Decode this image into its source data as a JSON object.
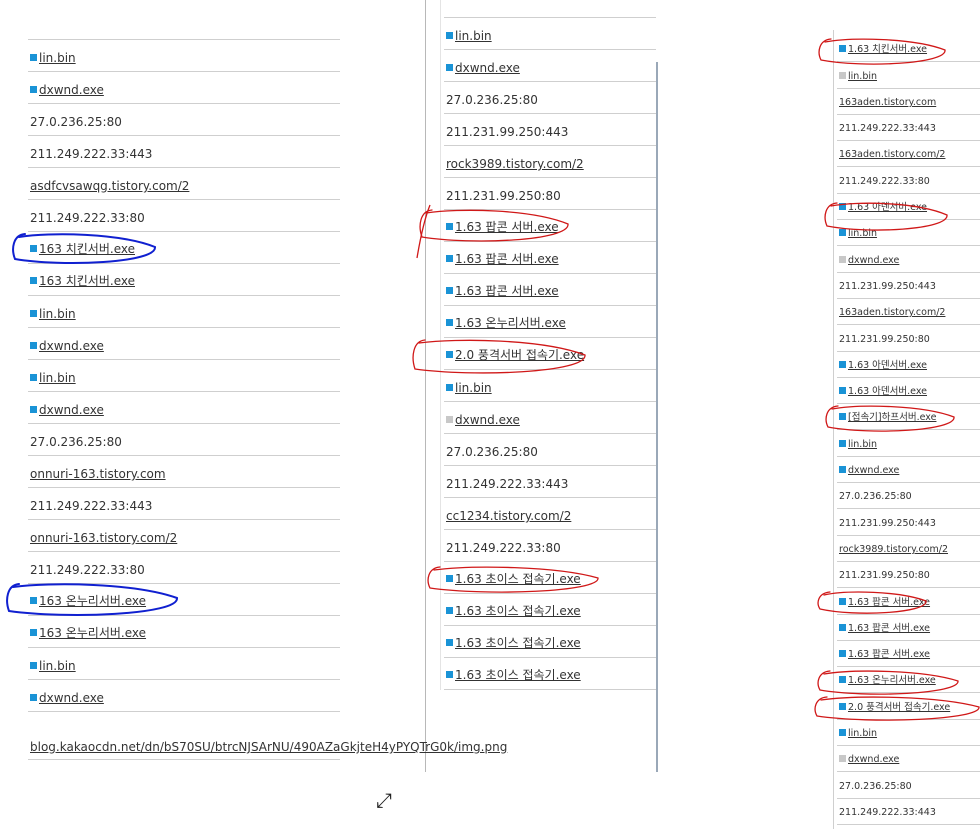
{
  "left_list": [
    {
      "text": "lin.bin",
      "icon": "blue",
      "link": true
    },
    {
      "text": "dxwnd.exe",
      "icon": "blue",
      "link": true
    },
    {
      "text": "27.0.236.25:80",
      "icon": "",
      "link": false
    },
    {
      "text": "211.249.222.33:443",
      "icon": "",
      "link": false
    },
    {
      "text": "asdfcvsawqg.tistory.com/2",
      "icon": "",
      "link": true
    },
    {
      "text": "211.249.222.33:80",
      "icon": "",
      "link": false
    },
    {
      "text": "163 치킨서버.exe",
      "icon": "blue",
      "link": true
    },
    {
      "text": "163 치킨서버.exe",
      "icon": "blue",
      "link": true
    },
    {
      "text": "lin.bin",
      "icon": "blue",
      "link": true
    },
    {
      "text": "dxwnd.exe",
      "icon": "blue",
      "link": true
    },
    {
      "text": "lin.bin",
      "icon": "blue",
      "link": true
    },
    {
      "text": "dxwnd.exe",
      "icon": "blue",
      "link": true
    },
    {
      "text": "27.0.236.25:80",
      "icon": "",
      "link": false
    },
    {
      "text": "onnuri-163.tistory.com",
      "icon": "",
      "link": true
    },
    {
      "text": "211.249.222.33:443",
      "icon": "",
      "link": false
    },
    {
      "text": "onnuri-163.tistory.com/2",
      "icon": "",
      "link": true
    },
    {
      "text": "211.249.222.33:80",
      "icon": "",
      "link": false
    },
    {
      "text": "163 온누리서버.exe",
      "icon": "blue",
      "link": true
    },
    {
      "text": "163 온누리서버.exe",
      "icon": "blue",
      "link": true
    },
    {
      "text": "lin.bin",
      "icon": "blue",
      "link": true
    },
    {
      "text": "dxwnd.exe",
      "icon": "blue",
      "link": true
    },
    {
      "text": "blog.kakaocdn.net/dn/bS70SU/btrcNJSArNU/490AZaGkjteH4yPYQTrG0k/img.png",
      "icon": "",
      "link": true,
      "tall": true
    }
  ],
  "middle_list": [
    {
      "text": "lin.bin",
      "icon": "blue",
      "link": true
    },
    {
      "text": "dxwnd.exe",
      "icon": "blue",
      "link": true
    },
    {
      "text": "27.0.236.25:80",
      "icon": "",
      "link": false
    },
    {
      "text": "211.231.99.250:443",
      "icon": "",
      "link": false
    },
    {
      "text": "rock3989.tistory.com/2",
      "icon": "",
      "link": true
    },
    {
      "text": "211.231.99.250:80",
      "icon": "",
      "link": false
    },
    {
      "text": "1.63 팝콘 서버.exe",
      "icon": "blue",
      "link": true
    },
    {
      "text": "1.63 팝콘 서버.exe",
      "icon": "blue",
      "link": true
    },
    {
      "text": "1.63 팝콘 서버.exe",
      "icon": "blue",
      "link": true
    },
    {
      "text": "1.63 온누리서버.exe",
      "icon": "blue",
      "link": true
    },
    {
      "text": "2.0 풍격서버 접속기.exe",
      "icon": "blue",
      "link": true
    },
    {
      "text": "lin.bin",
      "icon": "blue",
      "link": true
    },
    {
      "text": "dxwnd.exe",
      "icon": "gray",
      "link": true
    },
    {
      "text": "27.0.236.25:80",
      "icon": "",
      "link": false
    },
    {
      "text": "211.249.222.33:443",
      "icon": "",
      "link": false
    },
    {
      "text": "cc1234.tistory.com/2",
      "icon": "",
      "link": true
    },
    {
      "text": "211.249.222.33:80",
      "icon": "",
      "link": false
    },
    {
      "text": "1.63 초이스 접속기.exe",
      "icon": "blue",
      "link": true
    },
    {
      "text": "1.63 초이스 접속기.exe",
      "icon": "blue",
      "link": true
    },
    {
      "text": "1.63 초이스 접속기.exe",
      "icon": "blue",
      "link": true
    },
    {
      "text": "1.63 초이스 접속기.exe",
      "icon": "blue",
      "link": true
    }
  ],
  "right_list": [
    {
      "text": "1.63 치킨서버.exe",
      "icon": "blue",
      "link": true
    },
    {
      "text": "lin.bin",
      "icon": "gray",
      "link": true
    },
    {
      "text": "163aden.tistory.com",
      "icon": "",
      "link": true
    },
    {
      "text": "211.249.222.33:443",
      "icon": "",
      "link": false
    },
    {
      "text": "163aden.tistory.com/2",
      "icon": "",
      "link": true
    },
    {
      "text": "211.249.222.33:80",
      "icon": "",
      "link": false
    },
    {
      "text": "1.63 아덴서버.exe",
      "icon": "blue",
      "link": true
    },
    {
      "text": "lin.bin",
      "icon": "blue",
      "link": true
    },
    {
      "text": "dxwnd.exe",
      "icon": "gray",
      "link": true
    },
    {
      "text": "211.231.99.250:443",
      "icon": "",
      "link": false
    },
    {
      "text": "163aden.tistory.com/2",
      "icon": "",
      "link": true
    },
    {
      "text": "211.231.99.250:80",
      "icon": "",
      "link": false
    },
    {
      "text": "1.63 아덴서버.exe",
      "icon": "blue",
      "link": true
    },
    {
      "text": "1.63 아덴서버.exe",
      "icon": "blue",
      "link": true
    },
    {
      "text": "[접속기]하프서버.exe",
      "icon": "blue",
      "link": true
    },
    {
      "text": "lin.bin",
      "icon": "blue",
      "link": true
    },
    {
      "text": "dxwnd.exe",
      "icon": "blue",
      "link": true
    },
    {
      "text": "27.0.236.25:80",
      "icon": "",
      "link": false
    },
    {
      "text": "211.231.99.250:443",
      "icon": "",
      "link": false
    },
    {
      "text": "rock3989.tistory.com/2",
      "icon": "",
      "link": true
    },
    {
      "text": "211.231.99.250:80",
      "icon": "",
      "link": false
    },
    {
      "text": "1.63 팝콘 서버.exe",
      "icon": "blue",
      "link": true
    },
    {
      "text": "1.63 팝콘 서버.exe",
      "icon": "blue",
      "link": true
    },
    {
      "text": "1.63 팝콘 서버.exe",
      "icon": "blue",
      "link": true
    },
    {
      "text": "1.63 온누리서버.exe",
      "icon": "blue",
      "link": true
    },
    {
      "text": "2.0 풍격서버 접속기.exe",
      "icon": "blue",
      "link": true
    },
    {
      "text": "lin.bin",
      "icon": "blue",
      "link": true
    },
    {
      "text": "dxwnd.exe",
      "icon": "gray",
      "link": true
    },
    {
      "text": "27.0.236.25:80",
      "icon": "",
      "link": false
    },
    {
      "text": "211.249.222.33:443",
      "icon": "",
      "link": false
    }
  ],
  "annotation_colors": {
    "blue": "#1020d0",
    "red": "#d01818"
  }
}
